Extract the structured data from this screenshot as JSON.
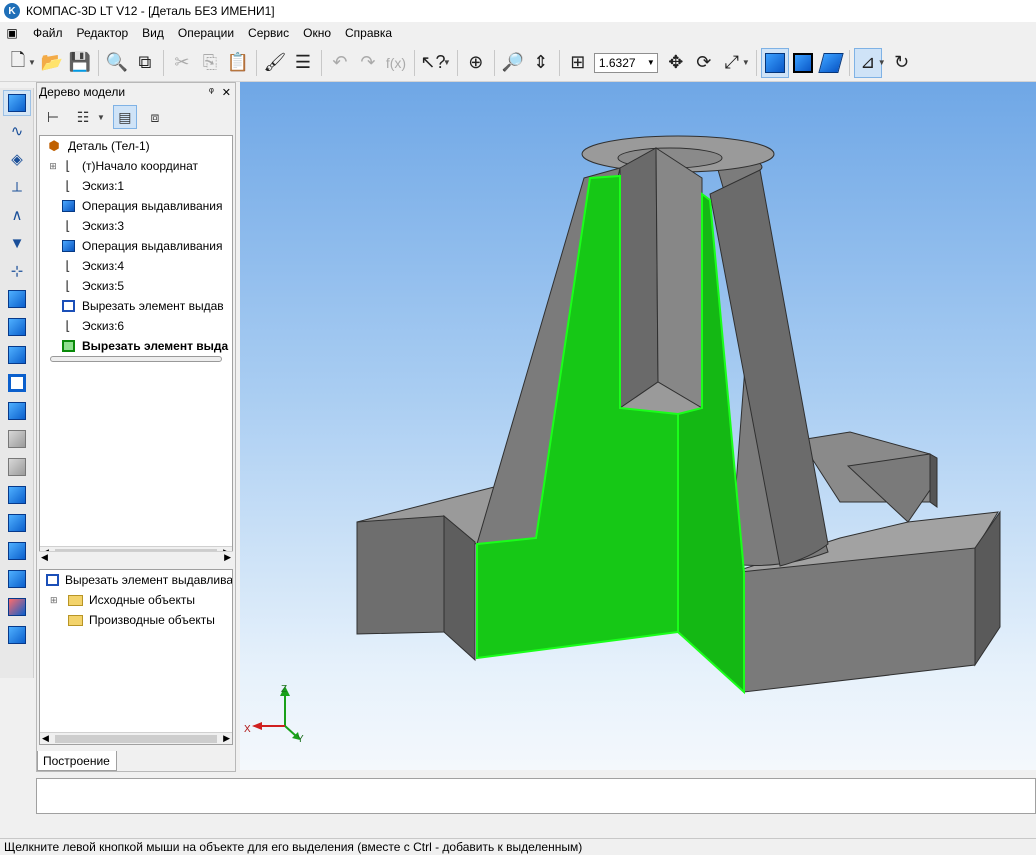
{
  "window": {
    "title": "КОМПАС-3D LT V12 - [Деталь БЕЗ ИМЕНИ1]",
    "app_icon": "kompas-logo-icon"
  },
  "menu": [
    "Файл",
    "Редактор",
    "Вид",
    "Операции",
    "Сервис",
    "Окно",
    "Справка"
  ],
  "toolbar": {
    "zoom_value": "1.6327"
  },
  "tree": {
    "title": "Дерево модели",
    "pin": "ᵠ",
    "close": "✕",
    "root": "Деталь (Тел-1)",
    "items": [
      {
        "label": "(т)Начало координат",
        "icon": "origin-icon"
      },
      {
        "label": "Эскиз:1",
        "icon": "sketch-icon"
      },
      {
        "label": "Операция выдавливания",
        "icon": "extrude-icon"
      },
      {
        "label": "Эскиз:3",
        "icon": "sketch-icon"
      },
      {
        "label": "Операция выдавливания",
        "icon": "extrude-icon"
      },
      {
        "label": "Эскиз:4",
        "icon": "sketch-icon"
      },
      {
        "label": "Эскиз:5",
        "icon": "sketch-icon"
      },
      {
        "label": "Вырезать элемент выдав",
        "icon": "cut-extrude-icon"
      },
      {
        "label": "Эскиз:6",
        "icon": "sketch-icon"
      },
      {
        "label": "Вырезать элемент выда",
        "icon": "cut-extrude-icon"
      }
    ]
  },
  "properties": {
    "root": "Вырезать элемент выдавлива",
    "items": [
      "Исходные объекты",
      "Производные объекты"
    ]
  },
  "tab_label": "Построение",
  "axes": {
    "x": "X",
    "y": "Y",
    "z": "Z"
  },
  "status": "Щелкните левой кнопкой мыши на объекте для его выделения (вместе с Ctrl - добавить к выделенным)",
  "colors": {
    "section_face": "#16c816",
    "model_grey": "#7a7a7a",
    "selection_edge": "#1aff1a"
  }
}
